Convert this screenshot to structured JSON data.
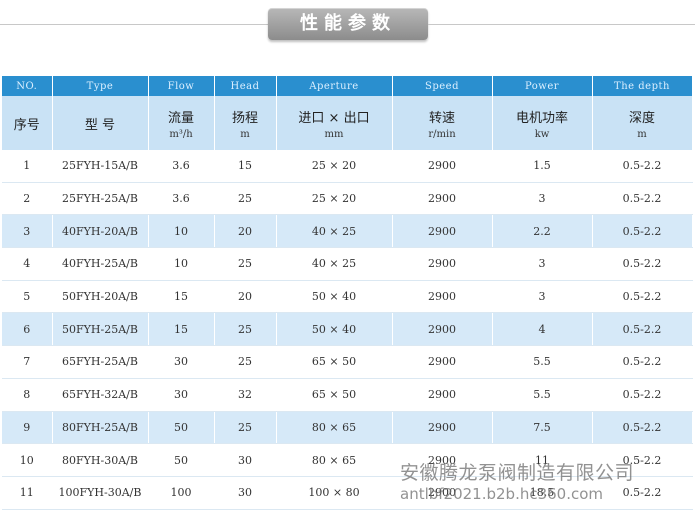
{
  "title": "性能参数",
  "table": {
    "en_headers": [
      "NO.",
      "Type",
      "Flow",
      "Head",
      "Aperture",
      "Speed",
      "Power",
      "The depth"
    ],
    "cn_headers": [
      {
        "main": "序号",
        "unit": ""
      },
      {
        "main": "型 号",
        "unit": ""
      },
      {
        "main": "流量",
        "unit": "m³/h"
      },
      {
        "main": "扬程",
        "unit": "m"
      },
      {
        "main": "进口 × 出口",
        "unit": "mm"
      },
      {
        "main": "转速",
        "unit": "r/min"
      },
      {
        "main": "电机功率",
        "unit": "kw"
      },
      {
        "main": "深度",
        "unit": "m"
      }
    ],
    "rows": [
      [
        "1",
        "25FYH-15A/B",
        "3.6",
        "15",
        "25 × 20",
        "2900",
        "1.5",
        "0.5-2.2"
      ],
      [
        "2",
        "25FYH-25A/B",
        "3.6",
        "25",
        "25 × 20",
        "2900",
        "3",
        "0.5-2.2"
      ],
      [
        "3",
        "40FYH-20A/B",
        "10",
        "20",
        "40 × 25",
        "2900",
        "2.2",
        "0.5-2.2"
      ],
      [
        "4",
        "40FYH-25A/B",
        "10",
        "25",
        "40 × 25",
        "2900",
        "3",
        "0.5-2.2"
      ],
      [
        "5",
        "50FYH-20A/B",
        "15",
        "20",
        "50 × 40",
        "2900",
        "3",
        "0.5-2.2"
      ],
      [
        "6",
        "50FYH-25A/B",
        "15",
        "25",
        "50 × 40",
        "2900",
        "4",
        "0.5-2.2"
      ],
      [
        "7",
        "65FYH-25A/B",
        "30",
        "25",
        "65 × 50",
        "2900",
        "5.5",
        "0.5-2.2"
      ],
      [
        "8",
        "65FYH-32A/B",
        "30",
        "32",
        "65 × 50",
        "2900",
        "5.5",
        "0.5-2.2"
      ],
      [
        "9",
        "80FYH-25A/B",
        "50",
        "25",
        "80 × 65",
        "2900",
        "7.5",
        "0.5-2.2"
      ],
      [
        "10",
        "80FYH-30A/B",
        "50",
        "30",
        "80 × 65",
        "2900",
        "11",
        "0.5-2.2"
      ],
      [
        "11",
        "100FYH-30A/B",
        "100",
        "30",
        "100 × 80",
        "2900",
        "18.5",
        "0.5-2.2"
      ]
    ],
    "highlighted_rows": [
      3,
      6,
      9
    ],
    "colors": {
      "header_blue": "#2a8fcf",
      "header_light": "#c9e2f5",
      "row_highlight": "#d6e9f8"
    }
  },
  "watermark": {
    "company": "安徽腾龙泵阀制造有限公司",
    "site": "antlbf2021.b2b.hc360.com"
  }
}
